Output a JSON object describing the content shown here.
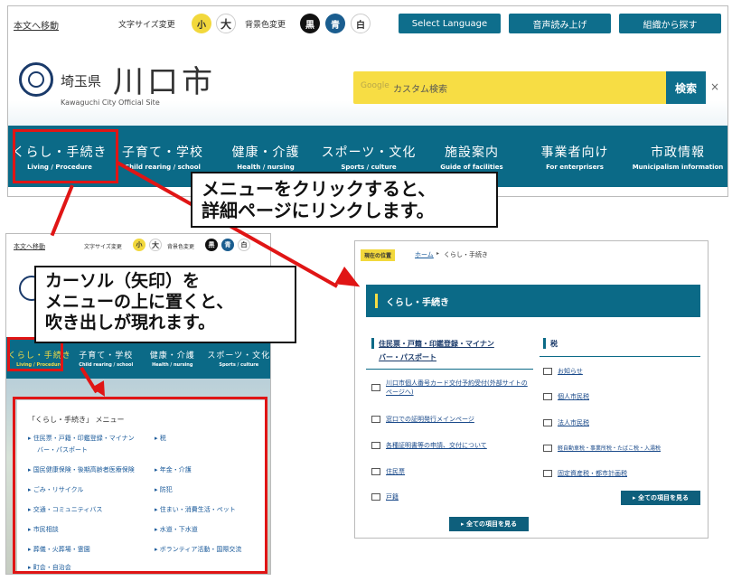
{
  "top": {
    "skip": "本文へ移動",
    "fontsize_label": "文字サイズ変更",
    "small": "小",
    "large": "大",
    "bg_label": "背景色変更",
    "black": "黒",
    "blue": "青",
    "white": "白",
    "lang": "Select Language",
    "voice": "音声読み上げ",
    "org": "組織から探す"
  },
  "logo": {
    "pref": "埼玉県",
    "city": "川口市",
    "en": "Kawaguchi City Official Site"
  },
  "search": {
    "google": "Google",
    "placeholder": "カスタム検索",
    "button": "検索",
    "clear": "×"
  },
  "nav": [
    {
      "jp": "くらし・手続き",
      "en": "Living / Procedure"
    },
    {
      "jp": "子育て・学校",
      "en": "Child rearing / school"
    },
    {
      "jp": "健康・介護",
      "en": "Health / nursing"
    },
    {
      "jp": "スポーツ・文化",
      "en": "Sports / culture"
    },
    {
      "jp": "施設案内",
      "en": "Guide of facilities"
    },
    {
      "jp": "事業者向け",
      "en": "For enterprisers"
    },
    {
      "jp": "市政情報",
      "en": "Municipalism information"
    }
  ],
  "callout1": {
    "line1": "メニューをクリックすると、",
    "line2": "詳細ページにリンクします。"
  },
  "callout2": {
    "line1": "カーソル（矢印）を",
    "line2": "メニューの上に置くと、",
    "line3": "吹き出しが現れます。"
  },
  "menu": {
    "title": "「くらし・手続き」 メニュー",
    "left": [
      "住民票・戸籍・印鑑登録・マイナン",
      "国民健康保険・後期高齢者医療保険",
      "ごみ・リサイクル",
      "交通・コミュニティバス",
      "市民相談",
      "葬儀・火葬場・霊園",
      "町会・自治会"
    ],
    "left_cont": "バー・パスポート",
    "right": [
      "税",
      "年金・介護",
      "防犯",
      "住まい・消費生活・ペット",
      "水道・下水道",
      "ボランティア活動・国際交流"
    ]
  },
  "detail": {
    "loc_label": "現在の位置",
    "home": "ホーム",
    "sep": "▸",
    "crumb": "くらし・手続き",
    "title": "くらし・手続き",
    "left_head1": "住民票・戸籍・印鑑登録・マイナン",
    "left_head2": "バー・パスポート",
    "left_items": [
      "川口市個人番号カード交付予約受付(外部サイトのページへ)",
      "窓口での証明発行メインページ",
      "各種証明書等の申請、交付について",
      "住民票",
      "戸籍"
    ],
    "right_head": "税",
    "right_items": [
      "お知らせ",
      "個人市民税",
      "法人市民税",
      "軽自動車税・事業所税・たばこ税・入湯税",
      "固定資産税・都市計画税"
    ],
    "see_all": "▸ 全ての項目を見る"
  }
}
